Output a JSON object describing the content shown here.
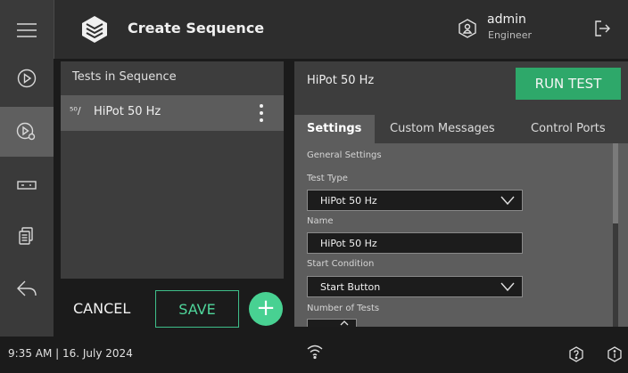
{
  "header": {
    "title": "Create Sequence"
  },
  "user": {
    "name": "admin",
    "role": "Engineer"
  },
  "sidebar": {
    "items": [
      {
        "icon": "menu-icon"
      },
      {
        "icon": "run-icon"
      },
      {
        "icon": "sequence-icon"
      },
      {
        "icon": "device-icon"
      },
      {
        "icon": "reports-icon"
      },
      {
        "icon": "back-icon"
      }
    ]
  },
  "sequence_panel": {
    "heading": "Tests in Sequence",
    "items": [
      {
        "icon_text": "⁵⁰∕",
        "label": "HiPot 50 Hz"
      }
    ]
  },
  "actions": {
    "cancel": "CANCEL",
    "save": "SAVE",
    "add": "+"
  },
  "test_panel": {
    "test_name": "HiPot 50 Hz",
    "run_label": "RUN TEST",
    "tabs": [
      "Settings",
      "Custom Messages",
      "Control Ports"
    ],
    "section": "General Settings",
    "fields": {
      "test_type": {
        "label": "Test Type",
        "value": "HiPot 50 Hz"
      },
      "name": {
        "label": "Name",
        "value": "HiPot 50 Hz"
      },
      "start_condition": {
        "label": "Start Condition",
        "value": "Start Button"
      },
      "number_of_tests": {
        "label": "Number of Tests"
      }
    }
  },
  "footer": {
    "datetime": "9:35 AM | 16. July 2024"
  },
  "colors": {
    "accent": "#2ea86a",
    "accent_light": "#48d192"
  }
}
